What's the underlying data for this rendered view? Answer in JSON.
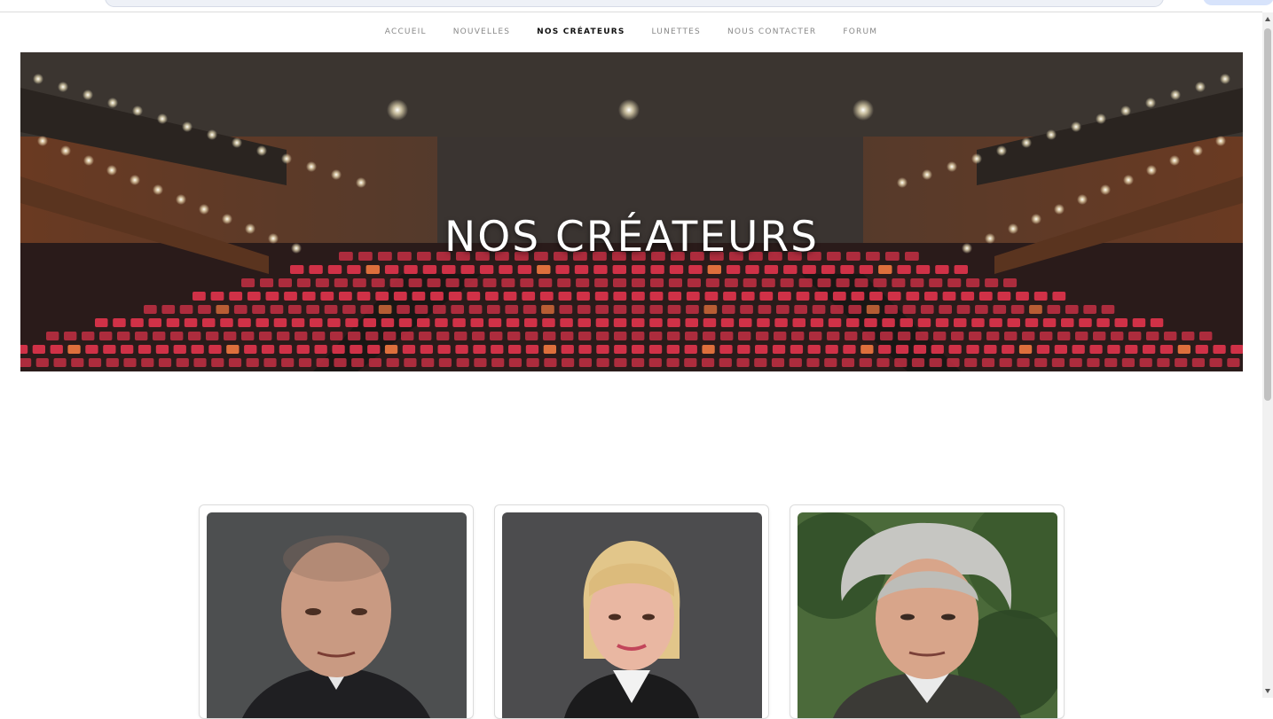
{
  "nav": {
    "items": [
      {
        "label": "ACCUEIL"
      },
      {
        "label": "NOUVELLES"
      },
      {
        "label": "NOS CRÉATEURS"
      },
      {
        "label": "LUNETTES"
      },
      {
        "label": "NOUS CONTACTER"
      },
      {
        "label": "FORUM"
      }
    ],
    "active_index": 2
  },
  "hero": {
    "title": "NOS CRÉATEURS",
    "image": "theater-auditorium-red-seats"
  },
  "creators": [
    {
      "photo": "man-bald-suit-portrait"
    },
    {
      "photo": "woman-blonde-portrait"
    },
    {
      "photo": "man-grey-hair-portrait"
    }
  ],
  "colors": {
    "seat_red": "#d9334a",
    "nav_active": "#111111",
    "nav_inactive": "#888888"
  }
}
